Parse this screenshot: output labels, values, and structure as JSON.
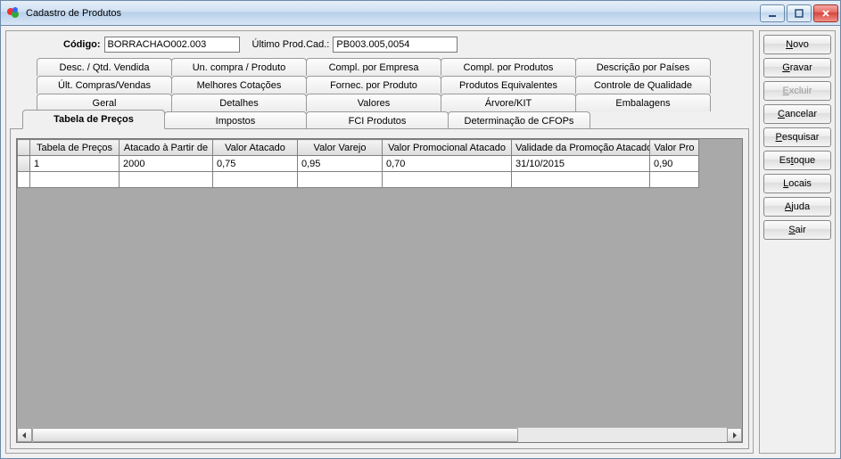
{
  "window": {
    "title": "Cadastro de Produtos"
  },
  "form": {
    "codigo_label": "Código:",
    "codigo_value": "BORRACHAO002.003",
    "ultimo_label": "Último Prod.Cad.:",
    "ultimo_value": "PB003.005,0054"
  },
  "tabs": {
    "row1": [
      "Desc. / Qtd. Vendida",
      "Un. compra / Produto",
      "Compl. por Empresa",
      "Compl. por Produtos",
      "Descrição por Países"
    ],
    "row2": [
      "Últ. Compras/Vendas",
      "Melhores Cotações",
      "Fornec. por Produto",
      "Produtos Equivalentes",
      "Controle de Qualidade"
    ],
    "row3": [
      "Geral",
      "Detalhes",
      "Valores",
      "Árvore/KIT",
      "Embalagens"
    ],
    "row4": [
      "Tabela de Preços",
      "Impostos",
      "FCI Produtos",
      "Determinação de CFOPs"
    ],
    "active": "Tabela de Preços"
  },
  "grid": {
    "columns": [
      "Tabela de Preços",
      "Atacado à Partir de",
      "Valor Atacado",
      "Valor Varejo",
      "Valor Promocional Atacado",
      "Validade da Promoção Atacado",
      "Valor Pro"
    ],
    "rows": [
      [
        "1",
        "2000",
        "0,75",
        "0,95",
        "0,70",
        "31/10/2015",
        "0,90"
      ]
    ]
  },
  "buttons": {
    "novo": "Novo",
    "gravar": "Gravar",
    "excluir": "Excluir",
    "cancelar": "Cancelar",
    "pesquisar": "Pesquisar",
    "estoque": "Estoque",
    "locais": "Locais",
    "ajuda": "Ajuda",
    "sair": "Sair"
  }
}
